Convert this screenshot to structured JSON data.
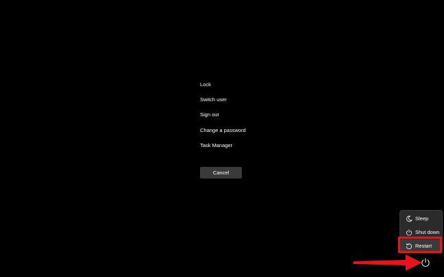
{
  "menu": {
    "items": [
      {
        "label": "Lock"
      },
      {
        "label": "Switch user"
      },
      {
        "label": "Sign out"
      },
      {
        "label": "Change a password"
      },
      {
        "label": "Task Manager"
      }
    ],
    "cancel_label": "Cancel"
  },
  "power_menu": {
    "items": [
      {
        "label": "Sleep",
        "icon": "moon-icon"
      },
      {
        "label": "Shut down",
        "icon": "power-icon"
      },
      {
        "label": "Restart",
        "icon": "restart-icon",
        "highlighted": true
      }
    ],
    "power_button_icon": "power-icon"
  },
  "colors": {
    "background": "#000000",
    "text": "#ffffff",
    "button_bg": "#3a3a3a",
    "flyout_bg": "#2b2b2b",
    "annotation": "#e8141b"
  }
}
